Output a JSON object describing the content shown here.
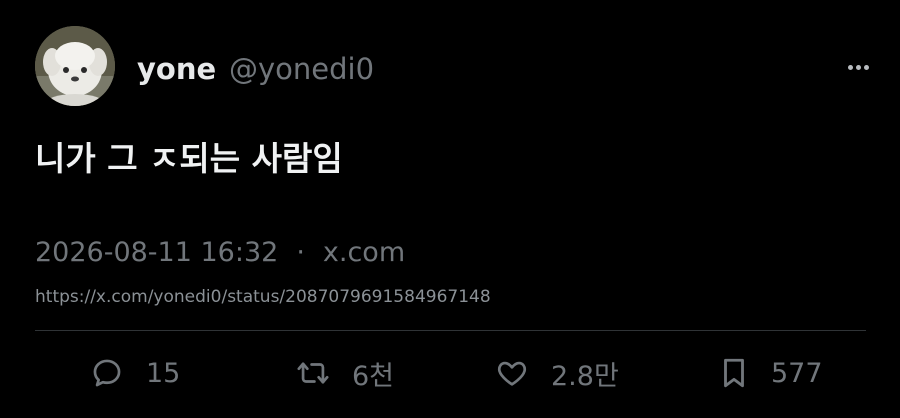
{
  "author": {
    "name": "yone",
    "handle": "@yonedi0"
  },
  "tweet": {
    "text": "니가 그 ㅈ되는 사람임"
  },
  "meta": {
    "timestamp": "2026-08-11 16:32",
    "separator": "·",
    "source": "x.com",
    "url": "https://x.com/yonedi0/status/2087079691584967148"
  },
  "actions": {
    "replies": "15",
    "retweets": "6천",
    "likes": "2.8만",
    "bookmarks": "577"
  },
  "icons": {
    "reply": "reply-icon",
    "retweet": "retweet-icon",
    "like": "heart-icon",
    "bookmark": "bookmark-icon",
    "more": "more-options-icon"
  },
  "colors": {
    "background": "#000000",
    "primary_text": "#e7e9ea",
    "secondary_text": "#71767b",
    "divider": "#2f3336"
  }
}
